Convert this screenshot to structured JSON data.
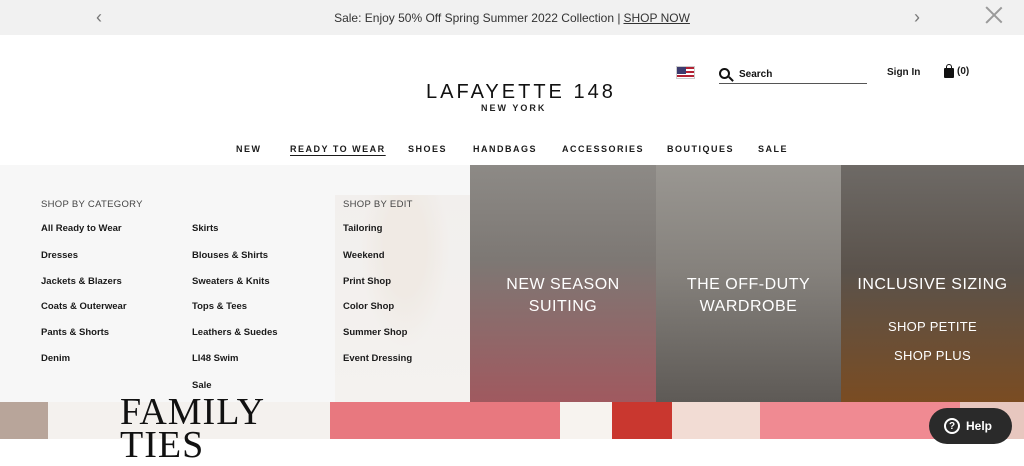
{
  "promo": {
    "text": "Sale: Enjoy 50% Off Spring Summer 2022 Collection |",
    "link": "SHOP NOW",
    "prev_icon": "chevron-left-icon",
    "next_icon": "chevron-right-icon",
    "close_icon": "close-icon"
  },
  "header": {
    "logo": "LAFAYETTE 148",
    "logo_sub": "NEW YORK",
    "flag_icon": "us-flag-icon",
    "search_placeholder": "Search",
    "sign_in": "Sign In",
    "cart_count": "(0)"
  },
  "nav": {
    "items": [
      "NEW",
      "READY TO WEAR",
      "SHOES",
      "HANDBAGS",
      "ACCESSORIES",
      "BOUTIQUES",
      "SALE"
    ],
    "active": "READY TO WEAR"
  },
  "menu": {
    "category_heading": "SHOP BY CATEGORY",
    "category_col1": [
      "All Ready to Wear",
      "Dresses",
      "Jackets & Blazers",
      "Coats & Outerwear",
      "Pants & Shorts",
      "Denim"
    ],
    "category_col2": [
      "Skirts",
      "Blouses & Shirts",
      "Sweaters & Knits",
      "Tops & Tees",
      "Leathers & Suedes",
      "LI48 Swim",
      "Sale"
    ],
    "edit_heading": "SHOP BY EDIT",
    "edit_items": [
      "Tailoring",
      "Weekend",
      "Print Shop",
      "Color Shop",
      "Summer Shop",
      "Event Dressing"
    ]
  },
  "tiles": [
    {
      "line1": "NEW SEASON",
      "line2": "SUITING"
    },
    {
      "line1": "THE OFF-DUTY",
      "line2": "WARDROBE"
    },
    {
      "line1": "INCLUSIVE SIZING",
      "link1": "SHOP PETITE",
      "link2": "SHOP PLUS"
    }
  ],
  "hero": {
    "title_line1": "FAMILY",
    "title_line2": "TIES"
  },
  "help": {
    "label": "Help",
    "icon": "question-icon"
  }
}
